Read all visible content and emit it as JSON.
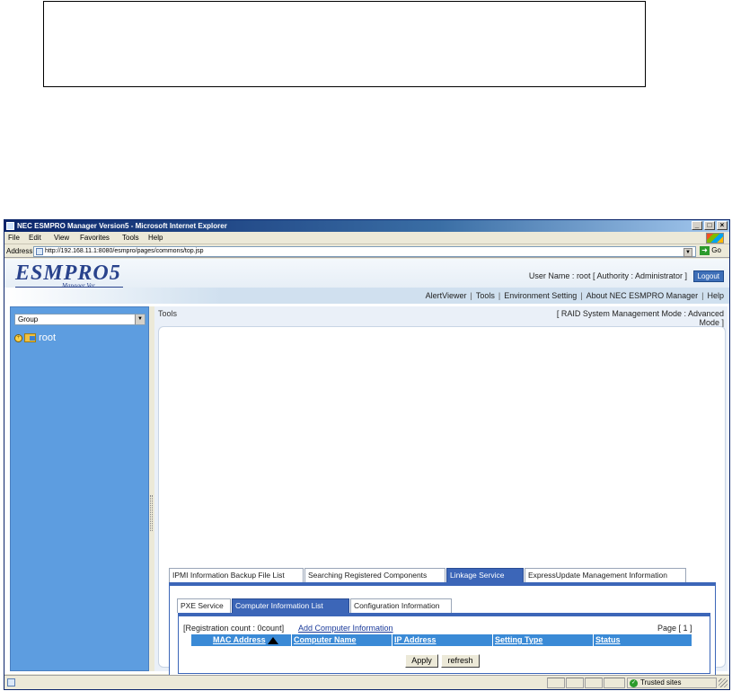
{
  "window": {
    "title": "NEC ESMPRO Manager Version5 - Microsoft Internet Explorer",
    "min": "_",
    "max": "□",
    "close": "×"
  },
  "menu": [
    "File",
    "Edit",
    "View",
    "Favorites",
    "Tools",
    "Help"
  ],
  "address": {
    "label": "Address",
    "url": "http://192.168.11.1:8080/esmpro/pages/commons/top.jsp",
    "go": "Go"
  },
  "header": {
    "logo": "ESMPRO5",
    "logo_sub": "Manager Ver.",
    "user_label": "User Name :",
    "user": "root",
    "authority": "[ Authority : Administrator ]",
    "logout": "Logout"
  },
  "nav": {
    "items": [
      "AlertViewer",
      "Tools",
      "Environment Setting",
      "About NEC ESMPRO Manager",
      "Help"
    ]
  },
  "sidebar": {
    "group_select": "Group",
    "tree_root": "root"
  },
  "main": {
    "section_title": "Tools",
    "mode": "[ RAID System Management Mode : Advanced Mode ]",
    "tabs": [
      {
        "label": "IPMI Information Backup File List",
        "active": false
      },
      {
        "label": "Searching Registered Components",
        "active": false
      },
      {
        "label": "Linkage Service",
        "active": true
      },
      {
        "label": "ExpressUpdate Management Information",
        "active": false
      }
    ],
    "subtabs": [
      {
        "label": "PXE Service",
        "active": false
      },
      {
        "label": "Computer Information List",
        "active": true
      },
      {
        "label": "Configuration Information",
        "active": false
      }
    ],
    "registration_count": "[Registration count : 0count]",
    "add_link": "Add Computer Information",
    "page": "Page [  1  ]",
    "table_columns": [
      "MAC Address",
      "Computer Name",
      "IP Address",
      "Setting Type",
      "Status"
    ],
    "apply": "Apply",
    "refresh": "refresh"
  },
  "status": {
    "zone": "Trusted sites"
  },
  "colors": {
    "title_bar": "#0a246a",
    "sidebar": "#5d9de0",
    "active_tab": "#3c66b8",
    "table_header": "#3a8ad6"
  }
}
